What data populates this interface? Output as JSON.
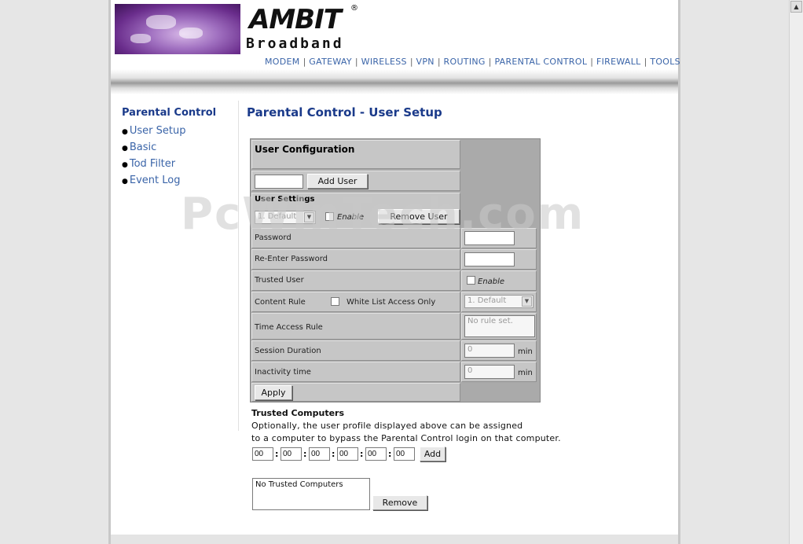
{
  "brand": {
    "name": "AMBIT",
    "registered": "®",
    "subtitle": "Broadband"
  },
  "nav": [
    "MODEM",
    "GATEWAY",
    "WIRELESS",
    "VPN",
    "ROUTING",
    "PARENTAL CONTROL",
    "FIREWALL",
    "TOOLS"
  ],
  "sidebar": {
    "title": "Parental Control",
    "items": [
      "User Setup",
      "Basic",
      "Tod Filter",
      "Event Log"
    ]
  },
  "main": {
    "title": "Parental Control - User Setup"
  },
  "config": {
    "header": "User Configuration",
    "add_user_value": "",
    "add_user_button": "Add User",
    "user_settings": "User Settings",
    "user_select": "1. Default",
    "enable_label": "Enable",
    "remove_user_button": "Remove User",
    "password_label": "Password",
    "reenter_label": "Re-Enter Password",
    "trusted_user_label": "Trusted User",
    "trusted_enable_label": "Enable",
    "content_rule_label": "Content Rule",
    "white_list_label": "White List Access Only",
    "content_rule_select": "1. Default",
    "time_access_label": "Time Access Rule",
    "time_access_value": "No rule set.",
    "session_label": "Session Duration",
    "session_value": "0",
    "session_unit": "min",
    "inactivity_label": "Inactivity time",
    "inactivity_value": "0",
    "inactivity_unit": "min",
    "apply_button": "Apply"
  },
  "trusted": {
    "title": "Trusted Computers",
    "line1": "Optionally, the user profile displayed above can be assigned",
    "line2": "to a computer to bypass the Parental Control login on that computer.",
    "mac": [
      "00",
      "00",
      "00",
      "00",
      "00",
      "00"
    ],
    "add_button": "Add",
    "list_value": "No Trusted Computers",
    "remove_button": "Remove"
  },
  "watermark": "PcWinTech.com"
}
